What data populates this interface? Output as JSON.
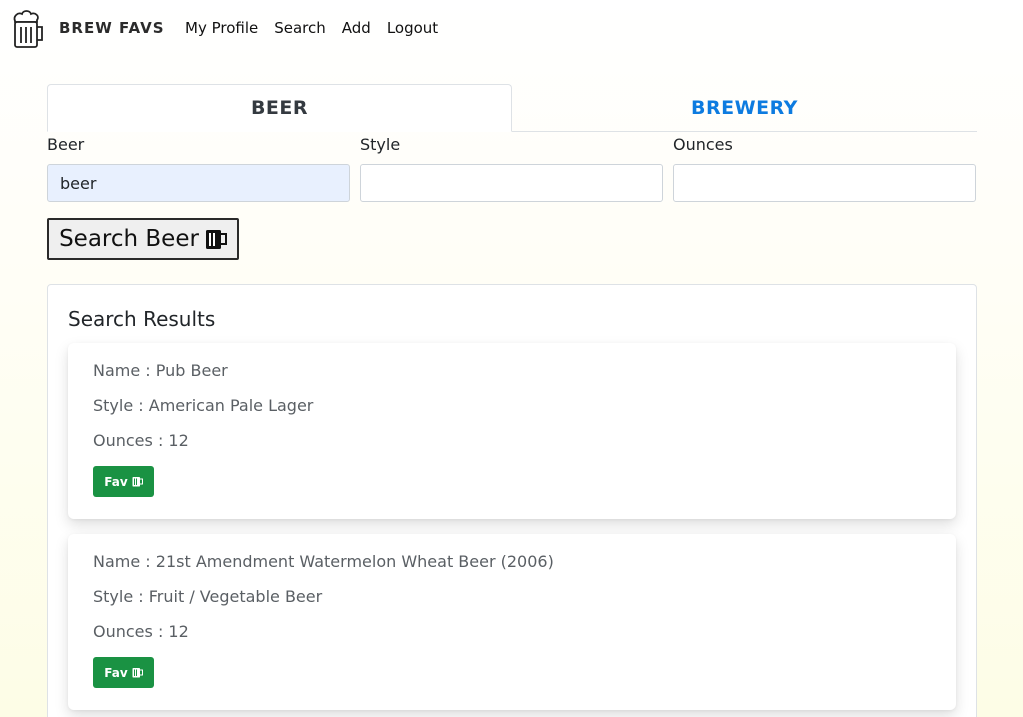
{
  "brand": {
    "name": "BREW FAVS",
    "logo_icon": "beer-mug-logo-icon"
  },
  "nav": [
    {
      "label": "My Profile"
    },
    {
      "label": "Search"
    },
    {
      "label": "Add"
    },
    {
      "label": "Logout"
    }
  ],
  "tabs": [
    {
      "label": "BEER",
      "active": true
    },
    {
      "label": "BREWERY",
      "active": false
    }
  ],
  "form": {
    "beer": {
      "label": "Beer",
      "value": "beer"
    },
    "style": {
      "label": "Style",
      "value": ""
    },
    "ounces": {
      "label": "Ounces",
      "value": ""
    },
    "submit_label": "Search Beer"
  },
  "results": {
    "title": "Search Results",
    "items": [
      {
        "name": "Name : Pub Beer",
        "style": "Style : American Pale Lager",
        "ounces": "Ounces : 12",
        "fav_label": "Fav"
      },
      {
        "name": "Name : 21st Amendment Watermelon Wheat Beer (2006)",
        "style": "Style : Fruit / Vegetable Beer",
        "ounces": "Ounces : 12",
        "fav_label": "Fav"
      }
    ]
  },
  "colors": {
    "accent": "#0d7be0",
    "fav_green": "#1a9243"
  }
}
